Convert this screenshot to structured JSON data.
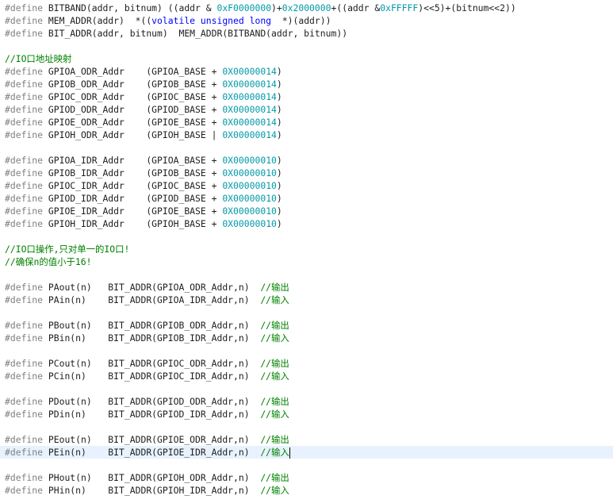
{
  "editor": {
    "lines": [
      [
        {
          "t": "#define",
          "c": "preproc"
        },
        {
          "t": " BITBAND(addr, bitnum) ((addr & ",
          "c": "plain"
        },
        {
          "t": "0xF0000000",
          "c": "number"
        },
        {
          "t": ")+",
          "c": "plain"
        },
        {
          "t": "0x2000000",
          "c": "number"
        },
        {
          "t": "+((addr &",
          "c": "plain"
        },
        {
          "t": "0xFFFFF",
          "c": "number"
        },
        {
          "t": ")<<5)+(bitnum<<2))",
          "c": "plain"
        }
      ],
      [
        {
          "t": "#define",
          "c": "preproc"
        },
        {
          "t": " MEM_ADDR(addr)  *((",
          "c": "plain"
        },
        {
          "t": "volatile unsigned long",
          "c": "keyword"
        },
        {
          "t": "  *)(addr))",
          "c": "plain"
        }
      ],
      [
        {
          "t": "#define",
          "c": "preproc"
        },
        {
          "t": " BIT_ADDR(addr, bitnum)  MEM_ADDR(BITBAND(addr, bitnum))",
          "c": "plain"
        }
      ],
      [],
      [
        {
          "t": "//IO口地址映射",
          "c": "comment"
        }
      ],
      [
        {
          "t": "#define",
          "c": "preproc"
        },
        {
          "t": " GPIOA_ODR_Addr    (GPIOA_BASE + ",
          "c": "plain"
        },
        {
          "t": "0X00000014",
          "c": "number"
        },
        {
          "t": ")",
          "c": "plain"
        }
      ],
      [
        {
          "t": "#define",
          "c": "preproc"
        },
        {
          "t": " GPIOB_ODR_Addr    (GPIOB_BASE + ",
          "c": "plain"
        },
        {
          "t": "0X00000014",
          "c": "number"
        },
        {
          "t": ")",
          "c": "plain"
        }
      ],
      [
        {
          "t": "#define",
          "c": "preproc"
        },
        {
          "t": " GPIOC_ODR_Addr    (GPIOC_BASE + ",
          "c": "plain"
        },
        {
          "t": "0X00000014",
          "c": "number"
        },
        {
          "t": ")",
          "c": "plain"
        }
      ],
      [
        {
          "t": "#define",
          "c": "preproc"
        },
        {
          "t": " GPIOD_ODR_Addr    (GPIOD_BASE + ",
          "c": "plain"
        },
        {
          "t": "0X00000014",
          "c": "number"
        },
        {
          "t": ")",
          "c": "plain"
        }
      ],
      [
        {
          "t": "#define",
          "c": "preproc"
        },
        {
          "t": " GPIOE_ODR_Addr    (GPIOE_BASE + ",
          "c": "plain"
        },
        {
          "t": "0X00000014",
          "c": "number"
        },
        {
          "t": ")",
          "c": "plain"
        }
      ],
      [
        {
          "t": "#define",
          "c": "preproc"
        },
        {
          "t": " GPIOH_ODR_Addr    (GPIOH_BASE | ",
          "c": "plain"
        },
        {
          "t": "0X00000014",
          "c": "number"
        },
        {
          "t": ")",
          "c": "plain"
        }
      ],
      [],
      [
        {
          "t": "#define",
          "c": "preproc"
        },
        {
          "t": " GPIOA_IDR_Addr    (GPIOA_BASE + ",
          "c": "plain"
        },
        {
          "t": "0X00000010",
          "c": "number"
        },
        {
          "t": ")",
          "c": "plain"
        }
      ],
      [
        {
          "t": "#define",
          "c": "preproc"
        },
        {
          "t": " GPIOB_IDR_Addr    (GPIOB_BASE + ",
          "c": "plain"
        },
        {
          "t": "0X00000010",
          "c": "number"
        },
        {
          "t": ")",
          "c": "plain"
        }
      ],
      [
        {
          "t": "#define",
          "c": "preproc"
        },
        {
          "t": " GPIOC_IDR_Addr    (GPIOC_BASE + ",
          "c": "plain"
        },
        {
          "t": "0X00000010",
          "c": "number"
        },
        {
          "t": ")",
          "c": "plain"
        }
      ],
      [
        {
          "t": "#define",
          "c": "preproc"
        },
        {
          "t": " GPIOD_IDR_Addr    (GPIOD_BASE + ",
          "c": "plain"
        },
        {
          "t": "0X00000010",
          "c": "number"
        },
        {
          "t": ")",
          "c": "plain"
        }
      ],
      [
        {
          "t": "#define",
          "c": "preproc"
        },
        {
          "t": " GPIOE_IDR_Addr    (GPIOE_BASE + ",
          "c": "plain"
        },
        {
          "t": "0X00000010",
          "c": "number"
        },
        {
          "t": ")",
          "c": "plain"
        }
      ],
      [
        {
          "t": "#define",
          "c": "preproc"
        },
        {
          "t": " GPIOH_IDR_Addr    (GPIOH_BASE + ",
          "c": "plain"
        },
        {
          "t": "0X00000010",
          "c": "number"
        },
        {
          "t": ")",
          "c": "plain"
        }
      ],
      [],
      [
        {
          "t": "//IO口操作,只对单一的IO口!",
          "c": "comment"
        }
      ],
      [
        {
          "t": "//确保n的值小于16!",
          "c": "comment"
        }
      ],
      [],
      [
        {
          "t": "#define",
          "c": "preproc"
        },
        {
          "t": " PAout(n)   BIT_ADDR(GPIOA_ODR_Addr,n)  ",
          "c": "plain"
        },
        {
          "t": "//输出",
          "c": "comment"
        }
      ],
      [
        {
          "t": "#define",
          "c": "preproc"
        },
        {
          "t": " PAin(n)    BIT_ADDR(GPIOA_IDR_Addr,n)  ",
          "c": "plain"
        },
        {
          "t": "//输入",
          "c": "comment"
        }
      ],
      [],
      [
        {
          "t": "#define",
          "c": "preproc"
        },
        {
          "t": " PBout(n)   BIT_ADDR(GPIOB_ODR_Addr,n)  ",
          "c": "plain"
        },
        {
          "t": "//输出",
          "c": "comment"
        }
      ],
      [
        {
          "t": "#define",
          "c": "preproc"
        },
        {
          "t": " PBin(n)    BIT_ADDR(GPIOB_IDR_Addr,n)  ",
          "c": "plain"
        },
        {
          "t": "//输入",
          "c": "comment"
        }
      ],
      [],
      [
        {
          "t": "#define",
          "c": "preproc"
        },
        {
          "t": " PCout(n)   BIT_ADDR(GPIOC_ODR_Addr,n)  ",
          "c": "plain"
        },
        {
          "t": "//输出",
          "c": "comment"
        }
      ],
      [
        {
          "t": "#define",
          "c": "preproc"
        },
        {
          "t": " PCin(n)    BIT_ADDR(GPIOC_IDR_Addr,n)  ",
          "c": "plain"
        },
        {
          "t": "//输入",
          "c": "comment"
        }
      ],
      [],
      [
        {
          "t": "#define",
          "c": "preproc"
        },
        {
          "t": " PDout(n)   BIT_ADDR(GPIOD_ODR_Addr,n)  ",
          "c": "plain"
        },
        {
          "t": "//输出",
          "c": "comment"
        }
      ],
      [
        {
          "t": "#define",
          "c": "preproc"
        },
        {
          "t": " PDin(n)    BIT_ADDR(GPIOD_IDR_Addr,n)  ",
          "c": "plain"
        },
        {
          "t": "//输入",
          "c": "comment"
        }
      ],
      [],
      [
        {
          "t": "#define",
          "c": "preproc"
        },
        {
          "t": " PEout(n)   BIT_ADDR(GPIOE_ODR_Addr,n)  ",
          "c": "plain"
        },
        {
          "t": "//输出",
          "c": "comment"
        }
      ],
      [
        {
          "t": "#define",
          "c": "preproc"
        },
        {
          "t": " PEin(n)    BIT_ADDR(GPIOE_IDR_Addr,n)  ",
          "c": "plain"
        },
        {
          "t": "//输入",
          "c": "comment"
        }
      ],
      [],
      [
        {
          "t": "#define",
          "c": "preproc"
        },
        {
          "t": " PHout(n)   BIT_ADDR(GPIOH_ODR_Addr,n)  ",
          "c": "plain"
        },
        {
          "t": "//输出",
          "c": "comment"
        }
      ],
      [
        {
          "t": "#define",
          "c": "preproc"
        },
        {
          "t": " PHin(n)    BIT_ADDR(GPIOH_IDR_Addr,n)  ",
          "c": "plain"
        },
        {
          "t": "//输入",
          "c": "comment"
        }
      ]
    ],
    "active_line": 35
  }
}
